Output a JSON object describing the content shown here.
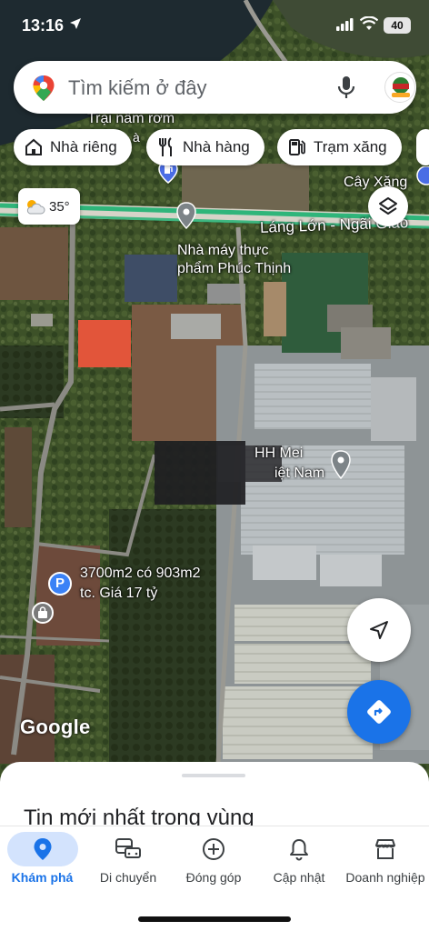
{
  "status": {
    "time": "13:16",
    "battery": "40"
  },
  "search": {
    "placeholder": "Tìm kiếm ở đây"
  },
  "chips": [
    {
      "label": "Nhà riêng",
      "icon": "home-icon"
    },
    {
      "label": "Nhà hàng",
      "icon": "restaurant-icon"
    },
    {
      "label": "Trạm xăng",
      "icon": "gas-station-icon"
    }
  ],
  "weather": {
    "temp": "35°",
    "icon": "partly-cloudy-icon"
  },
  "map_labels": {
    "top_partial": "Trại nấm rơm",
    "top_partial_2": "à",
    "fuel_station": "Cây Xăng",
    "road": "Láng Lớn - Ngãi Giao",
    "factory_line1": "Nhà máy thực",
    "factory_line2": "phẩm Phúc Thịnh",
    "company_partial": "HH Mei",
    "company_partial_2": "iệt Nam",
    "listing_line1": "3700m2 có 903m2",
    "listing_line2": "tc. Giá 17 tỷ",
    "watermark": "Google"
  },
  "sheet": {
    "title": "Tin mới nhất trong vùng"
  },
  "nav": [
    {
      "label": "Khám phá",
      "icon": "explore-pin-icon",
      "active": true
    },
    {
      "label": "Di chuyển",
      "icon": "commute-icon",
      "active": false
    },
    {
      "label": "Đóng góp",
      "icon": "add-circle-icon",
      "active": false
    },
    {
      "label": "Cập nhật",
      "icon": "bell-icon",
      "active": false
    },
    {
      "label": "Doanh nghiệp",
      "icon": "storefront-icon",
      "active": false
    }
  ]
}
